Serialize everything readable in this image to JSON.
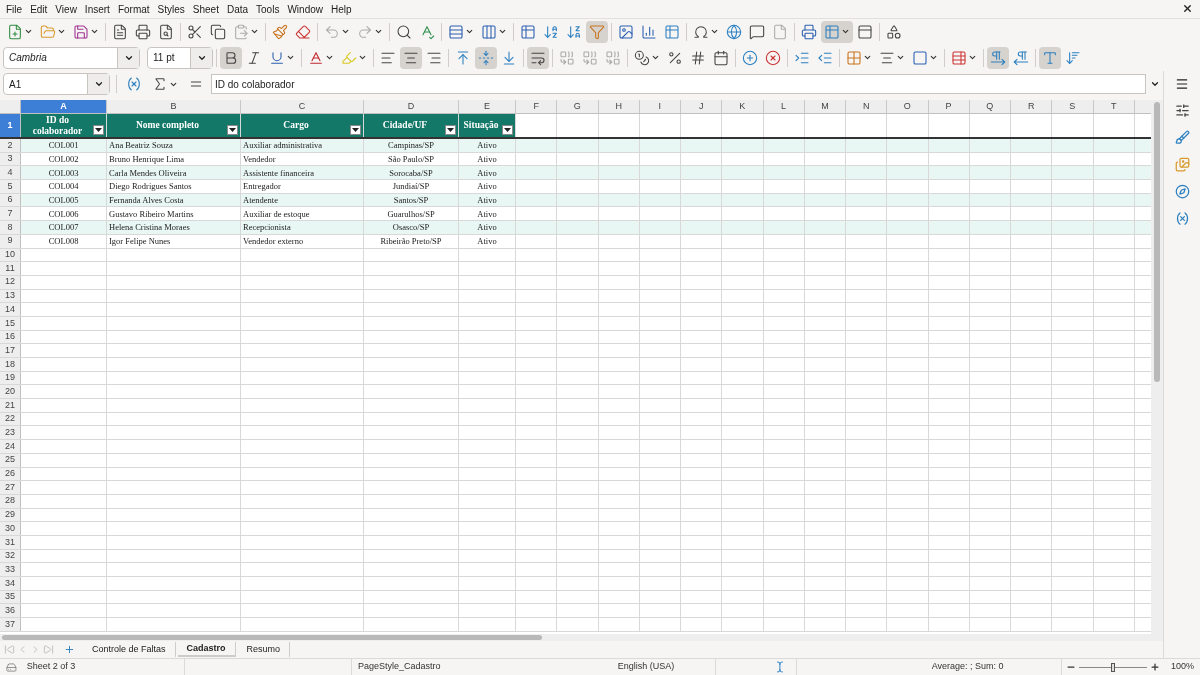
{
  "menu": [
    "File",
    "Edit",
    "View",
    "Insert",
    "Format",
    "Styles",
    "Sheet",
    "Data",
    "Tools",
    "Window",
    "Help"
  ],
  "toolbar": {
    "autofilter": true,
    "freeze": true
  },
  "format_bar": {
    "font": "Cambria",
    "size": "11 pt",
    "bold": true,
    "italic": false,
    "underline": false,
    "align_left": false,
    "align_center": true,
    "align_right": false,
    "valign_top": false,
    "valign_middle": true,
    "valign_bottom": false,
    "wrap": true,
    "ltr": true,
    "horizontal_text": true
  },
  "formula_bar": {
    "cell": "A1",
    "content": "ID do colaborador"
  },
  "sheet": {
    "columns": [
      {
        "letter": "A",
        "selected": true
      },
      {
        "letter": "B",
        "selected": false
      },
      {
        "letter": "C",
        "selected": false
      },
      {
        "letter": "D",
        "selected": false
      },
      {
        "letter": "E",
        "selected": false
      },
      {
        "letter": "F",
        "selected": false
      },
      {
        "letter": "G",
        "selected": false
      },
      {
        "letter": "H",
        "selected": false
      },
      {
        "letter": "I",
        "selected": false
      },
      {
        "letter": "J",
        "selected": false
      },
      {
        "letter": "K",
        "selected": false
      },
      {
        "letter": "L",
        "selected": false
      },
      {
        "letter": "M",
        "selected": false
      },
      {
        "letter": "N",
        "selected": false
      },
      {
        "letter": "O",
        "selected": false
      },
      {
        "letter": "P",
        "selected": false
      },
      {
        "letter": "Q",
        "selected": false
      },
      {
        "letter": "R",
        "selected": false
      },
      {
        "letter": "S",
        "selected": false
      },
      {
        "letter": "T",
        "selected": false
      }
    ],
    "rows": [
      {
        "number": "1",
        "selected": true,
        "kind": "header",
        "cells": [
          "ID do colaborador",
          "Nome completo",
          "Cargo",
          "Cidade/UF",
          "Situação"
        ]
      },
      {
        "number": "2",
        "selected": false,
        "kind": "data",
        "striped": true,
        "cells": [
          "COL001",
          "Ana Beatriz Souza",
          "Auxiliar administrativa",
          "Campinas/SP",
          "Ativo"
        ]
      },
      {
        "number": "3",
        "selected": false,
        "kind": "data",
        "striped": false,
        "cells": [
          "COL002",
          "Bruno Henrique Lima",
          "Vendedor",
          "São Paulo/SP",
          "Ativo"
        ]
      },
      {
        "number": "4",
        "selected": false,
        "kind": "data",
        "striped": true,
        "cells": [
          "COL003",
          "Carla Mendes Oliveira",
          "Assistente financeira",
          "Sorocaba/SP",
          "Ativo"
        ]
      },
      {
        "number": "5",
        "selected": false,
        "kind": "data",
        "striped": false,
        "cells": [
          "COL004",
          "Diego Rodrigues Santos",
          "Entregador",
          "Jundiaí/SP",
          "Ativo"
        ]
      },
      {
        "number": "6",
        "selected": false,
        "kind": "data",
        "striped": true,
        "cells": [
          "COL005",
          "Fernanda Alves Costa",
          "Atendente",
          "Santos/SP",
          "Ativo"
        ]
      },
      {
        "number": "7",
        "selected": false,
        "kind": "data",
        "striped": false,
        "cells": [
          "COL006",
          "Gustavo Ribeiro Martins",
          "Auxiliar de estoque",
          "Guarulhos/SP",
          "Ativo"
        ]
      },
      {
        "number": "8",
        "selected": false,
        "kind": "data",
        "striped": true,
        "cells": [
          "COL007",
          "Helena Cristina Moraes",
          "Recepcionista",
          "Osasco/SP",
          "Ativo"
        ]
      },
      {
        "number": "9",
        "selected": false,
        "kind": "data",
        "striped": false,
        "cells": [
          "COL008",
          "Igor Felipe Nunes",
          "Vendedor externo",
          "Ribeirão Preto/SP",
          "Ativo"
        ]
      },
      {
        "number": "10",
        "selected": false
      },
      {
        "number": "11",
        "selected": false
      },
      {
        "number": "12",
        "selected": false
      },
      {
        "number": "13",
        "selected": false
      },
      {
        "number": "14",
        "selected": false
      },
      {
        "number": "15",
        "selected": false
      },
      {
        "number": "16",
        "selected": false
      },
      {
        "number": "17",
        "selected": false
      },
      {
        "number": "18",
        "selected": false
      },
      {
        "number": "19",
        "selected": false
      },
      {
        "number": "20",
        "selected": false
      },
      {
        "number": "21",
        "selected": false
      },
      {
        "number": "22",
        "selected": false
      },
      {
        "number": "23",
        "selected": false
      },
      {
        "number": "24",
        "selected": false
      },
      {
        "number": "25",
        "selected": false
      },
      {
        "number": "26",
        "selected": false
      },
      {
        "number": "27",
        "selected": false
      },
      {
        "number": "28",
        "selected": false
      },
      {
        "number": "29",
        "selected": false
      },
      {
        "number": "30",
        "selected": false
      },
      {
        "number": "31",
        "selected": false
      },
      {
        "number": "32",
        "selected": false
      },
      {
        "number": "33",
        "selected": false
      },
      {
        "number": "34",
        "selected": false
      },
      {
        "number": "35",
        "selected": false
      },
      {
        "number": "36",
        "selected": false
      },
      {
        "number": "37",
        "selected": false
      }
    ]
  },
  "sheet_tabs": [
    {
      "label": "Controle de Faltas",
      "selected": false
    },
    {
      "label": "Cadastro",
      "selected": true
    },
    {
      "label": "Resumo",
      "selected": false
    }
  ],
  "status_bar": {
    "sheet": "Sheet 2 of 3",
    "page_style": "PageStyle_Cadastro",
    "language": "English (USA)",
    "summary": "Average: ; Sum: 0",
    "zoom": {
      "level": 0.5,
      "reading": "100%"
    }
  }
}
